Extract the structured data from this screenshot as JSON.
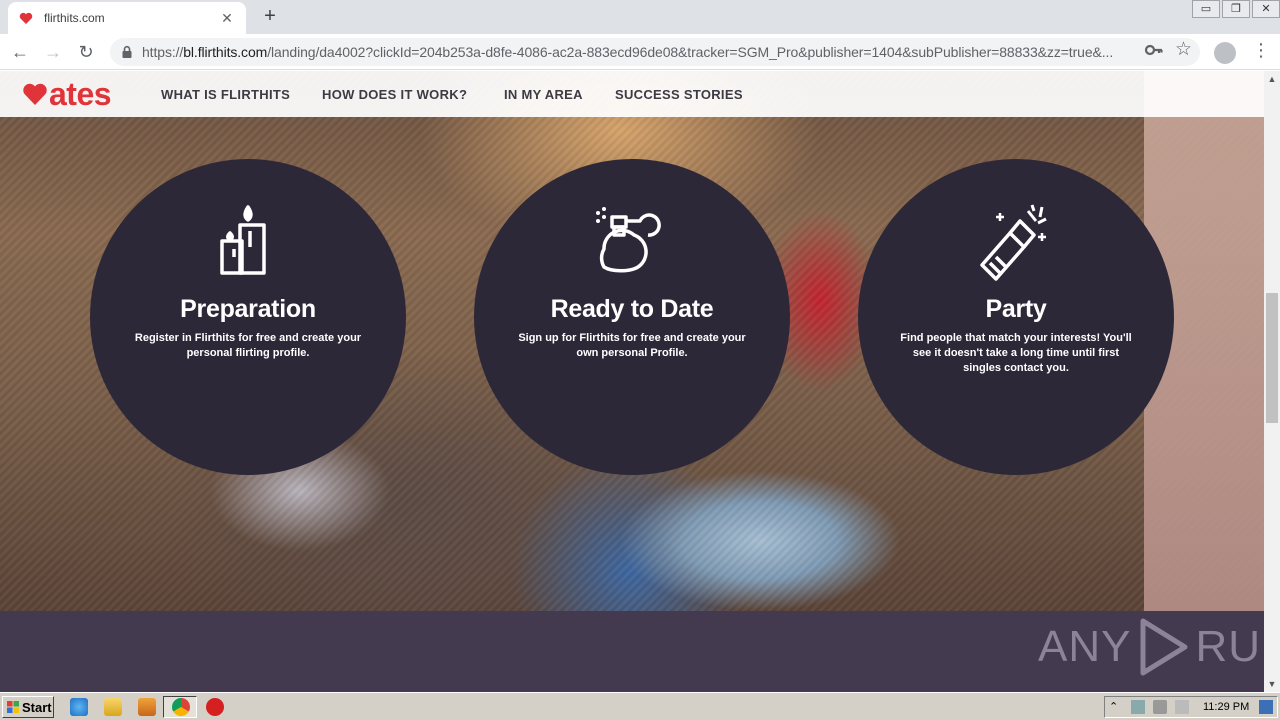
{
  "browser": {
    "tab_title": "flirthits.com",
    "tab_close": "✕",
    "new_tab": "+",
    "url_scheme": "https://",
    "url_host": "bl.flirthits.com",
    "url_path": "/landing/da4002?clickId=204b253a-d8fe-4086-ac2a-883ecd96de08&tracker=SGM_Pro&publisher=1404&subPublisher=88833&zz=true&...",
    "back": "←",
    "forward": "→",
    "reload": "↻",
    "bookmark": "☆",
    "menu": "⋮",
    "window_controls": [
      "▭",
      "❐",
      "✕"
    ]
  },
  "site": {
    "logo_text": "ates",
    "nav": [
      "WHAT IS FLIRTHITS",
      "HOW DOES IT WORK?",
      "IN MY AREA",
      "SUCCESS STORIES"
    ],
    "cards": [
      {
        "title": "Preparation",
        "text": "Register in Flirthits for free and create your personal flirting profile.",
        "icon": "candles-icon"
      },
      {
        "title": "Ready to Date",
        "text": "Sign up for Flirthits for free and create your own personal Profile.",
        "icon": "perfume-icon"
      },
      {
        "title": "Party",
        "text": "Find people that match your interests! You'll see it doesn't take a long time until first singles contact you.",
        "icon": "champagne-icon"
      }
    ],
    "watermark_left": "ANY",
    "watermark_right": "RUN"
  },
  "taskbar": {
    "start_label": "Start",
    "clock": "11:29 PM"
  },
  "colors": {
    "brand_red": "#e0333a",
    "circle_bg": "#2d2838",
    "band_bg": "#433a50"
  }
}
